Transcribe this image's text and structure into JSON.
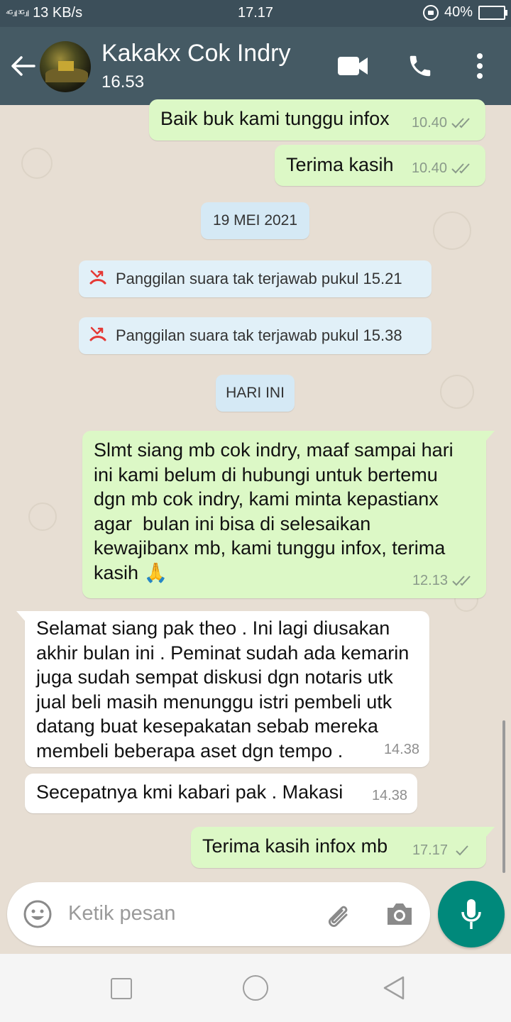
{
  "status_bar": {
    "signal": "⁴ᴳ.ıl ³ᴳ.ıl",
    "speed": "13 KB/s",
    "time": "17.17",
    "battery": "40%"
  },
  "header": {
    "contact_name": "Kakakx Cok Indry",
    "last_seen": "16.53"
  },
  "messages": [
    {
      "text": "Baik buk kami tunggu infox",
      "time": "10.40"
    },
    {
      "text": "Terima kasih",
      "time": "10.40"
    },
    {
      "text_lines": [
        "Slmt siang mb cok indry, maaf sampai hari",
        "ini kami belum di hubungi untuk bertemu",
        "dgn mb cok indry, kami minta kepastianx",
        "agar  bulan ini bisa di selesaikan",
        "kewajibanx mb, kami tunggu infox, terima",
        "kasih 🙏"
      ],
      "time": "12.13"
    },
    {
      "text_lines": [
        "Selamat siang pak theo . Ini lagi diusakan",
        "akhir bulan ini . Peminat sudah ada kemarin",
        "juga sudah sempat diskusi dgn notaris utk",
        "jual beli masih menunggu istri pembeli utk",
        "datang buat kesepakatan sebab mereka",
        "membeli beberapa aset dgn tempo ."
      ],
      "time": "14.38"
    },
    {
      "text": "Secepatnya kmi kabari pak . Makasi",
      "time": "14.38"
    },
    {
      "text": "Terima kasih infox mb",
      "time": "17.17"
    }
  ],
  "dates": {
    "date1": "19 MEI 2021",
    "today": "HARI INI"
  },
  "system": {
    "missed1": "Panggilan suara tak terjawab pukul 15.21",
    "missed2": "Panggilan suara tak terjawab pukul 15.38"
  },
  "input": {
    "placeholder": "Ketik pesan"
  },
  "colors": {
    "header": "#455a64",
    "outgoing_bubble": "#dcf8c6",
    "incoming_bubble": "#ffffff",
    "fab": "#00897b",
    "missed_call": "#e53935"
  },
  "icons": [
    "back-arrow-icon",
    "video-call-icon",
    "phone-icon",
    "more-options-icon",
    "missed-call-icon",
    "emoji-icon",
    "attachment-icon",
    "camera-icon",
    "microphone-icon"
  ]
}
